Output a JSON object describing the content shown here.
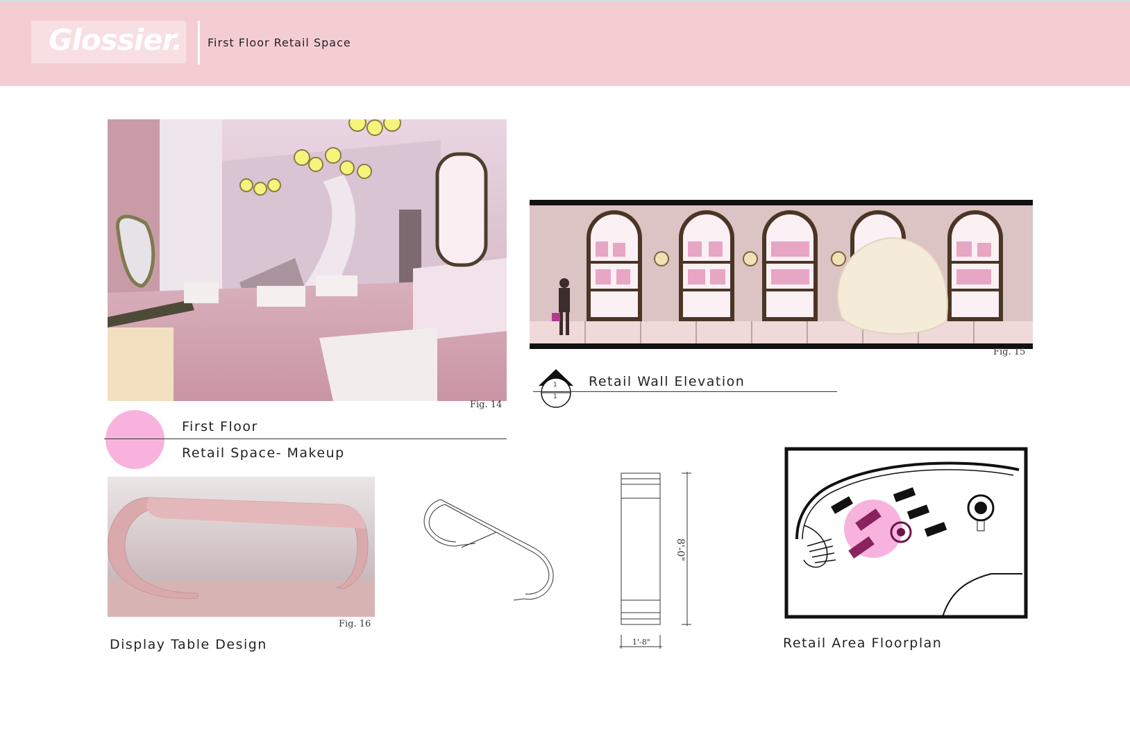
{
  "header": {
    "logo": "Glossier.",
    "title": "First Floor Retail Space"
  },
  "figures": {
    "fig14": "Fig. 14",
    "fig15": "Fig. 15",
    "fig16": "Fig. 16"
  },
  "captions": {
    "first_floor": "First Floor",
    "retail_space_makeup": "Retail Space- Makeup",
    "retail_wall_elevation": "Retail Wall Elevation",
    "display_table_design": "Display Table Design",
    "retail_area_floorplan": "Retail Area Floorplan"
  },
  "section_marker": {
    "top": "1",
    "bottom": "1"
  },
  "dimensions": {
    "height": "8'-0\"",
    "width": "1'-8\""
  },
  "colors": {
    "header_bg": "#f4cdd3",
    "accent_pink": "#f7b3de",
    "wall_pink": "#dcc3c4"
  }
}
